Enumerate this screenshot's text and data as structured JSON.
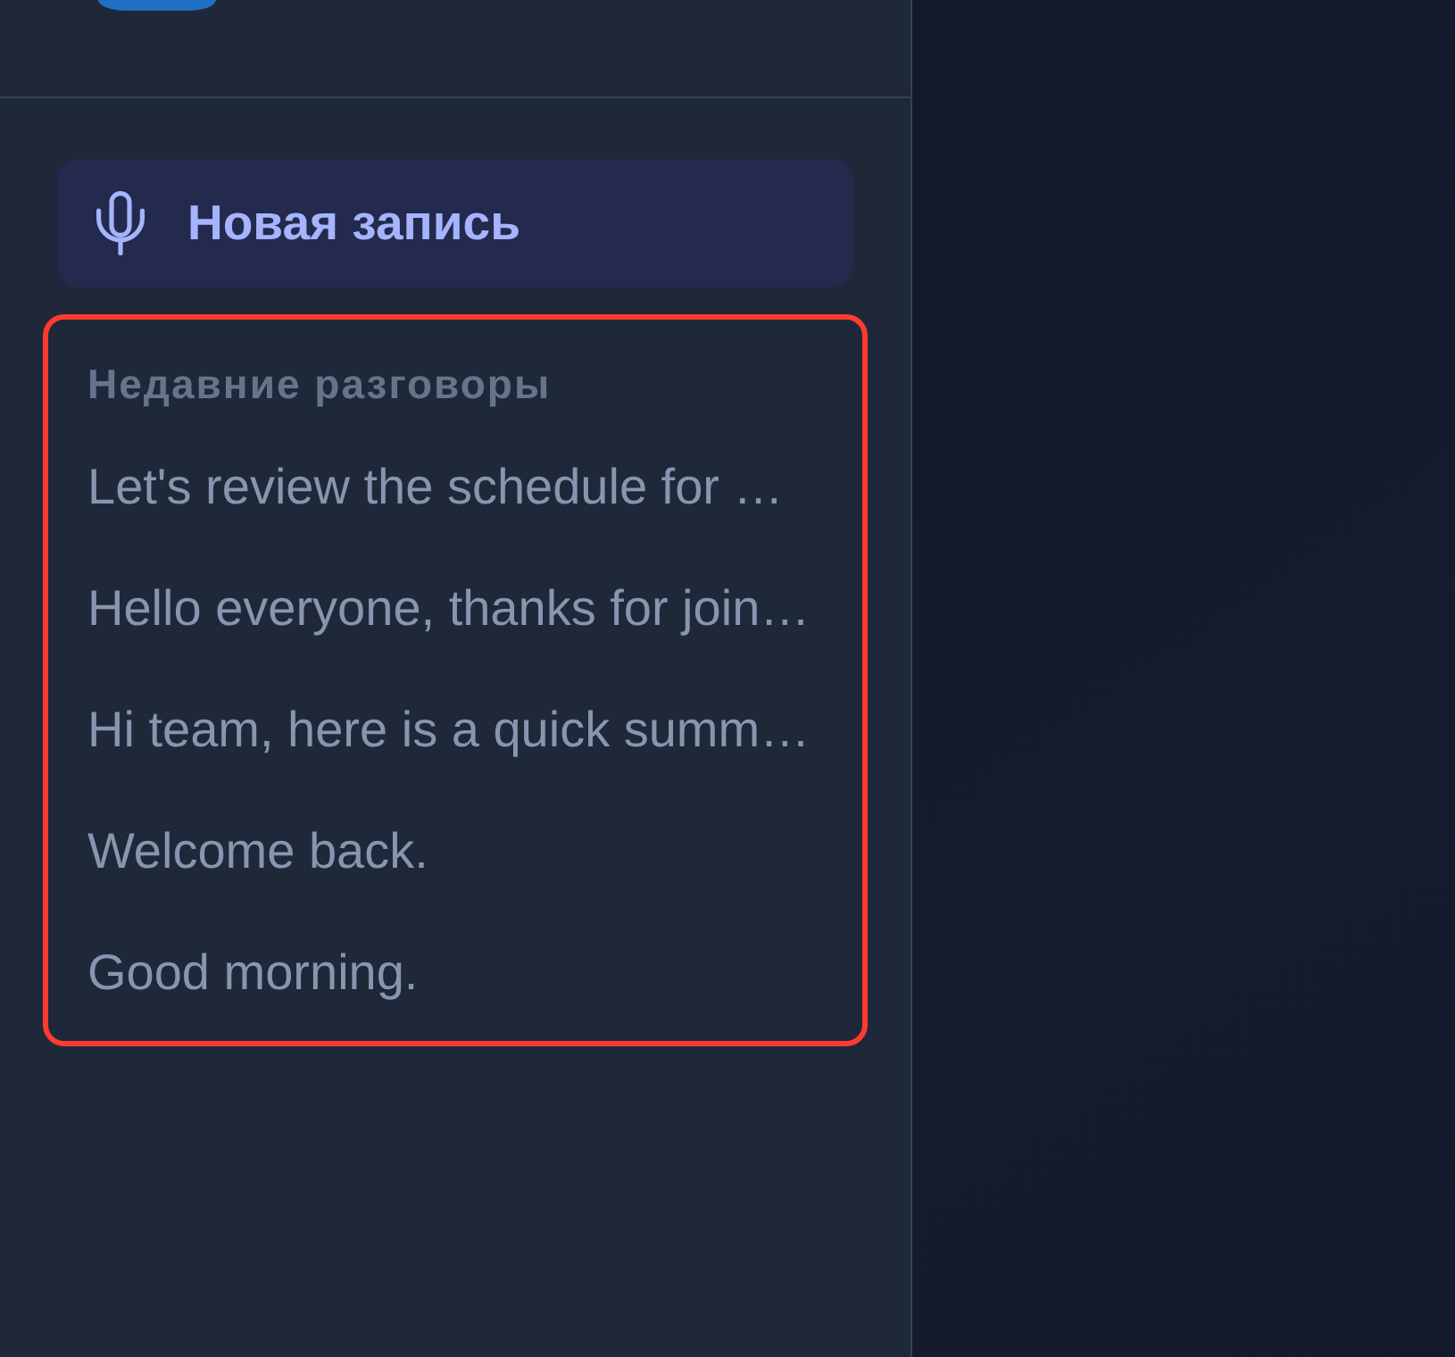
{
  "new_recording_button": {
    "label": "Новая запись"
  },
  "recent_conversations": {
    "title": "Недавние разговоры",
    "highlighted": true,
    "items": [
      "Let's review the schedule for …",
      "Hello everyone, thanks for join…",
      "Hi team, here is a quick summ…",
      "Welcome back.",
      "Good morning."
    ]
  }
}
